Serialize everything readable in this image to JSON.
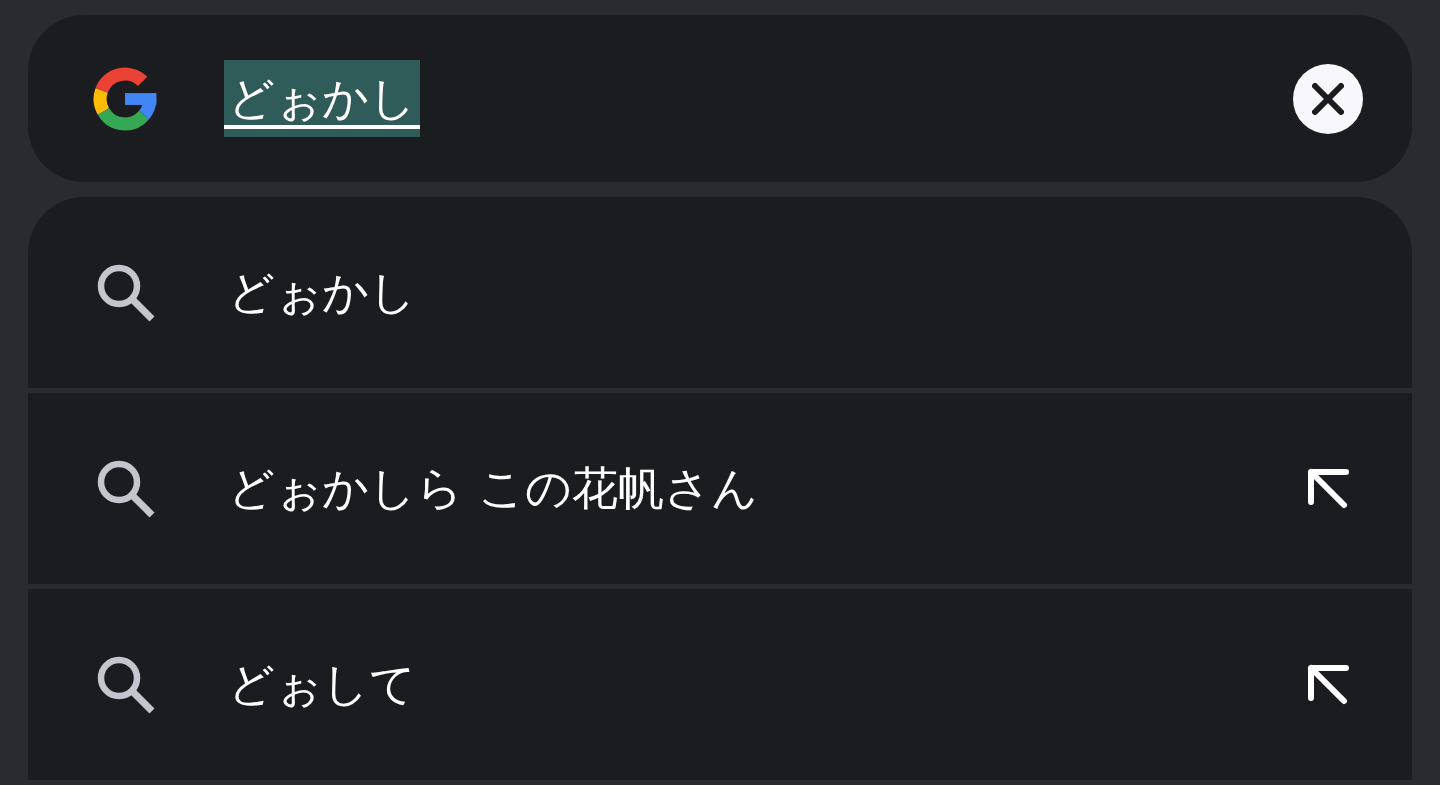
{
  "search_bar": {
    "query": "どぉかし",
    "composing": true
  },
  "suggestions": [
    {
      "text": "どぉかし",
      "fill_in": false
    },
    {
      "text": "どぉかしら この花帆さん",
      "fill_in": true
    },
    {
      "text": "どぉして",
      "fill_in": true
    }
  ]
}
